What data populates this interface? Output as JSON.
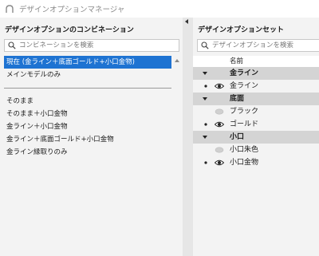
{
  "window": {
    "title": "デザインオプションマネージャ"
  },
  "left": {
    "title": "デザインオプションのコンビネーション",
    "search_placeholder": "コンビネーションを検索",
    "items_top": [
      {
        "label": "現在 (金ライン＋底面ゴールド+小口金物)",
        "selected": true
      },
      {
        "label": "メインモデルのみ",
        "selected": false
      }
    ],
    "items_bottom": [
      {
        "label": "そのまま"
      },
      {
        "label": "そのまま＋小口金物"
      },
      {
        "label": "金ライン＋小口金物"
      },
      {
        "label": "金ライン＋底面ゴールド+小口金物"
      },
      {
        "label": "金ライン縁取りのみ"
      }
    ]
  },
  "right": {
    "title": "デザインオプションセット",
    "search_placeholder": "デザインオプションを検索",
    "column_header": "名前",
    "groups": [
      {
        "name": "金ライン",
        "options": [
          {
            "name": "金ライン",
            "visible": true
          }
        ]
      },
      {
        "name": "底面",
        "options": [
          {
            "name": "ブラック",
            "visible": false
          },
          {
            "name": "ゴールド",
            "visible": true
          }
        ]
      },
      {
        "name": "小口",
        "options": [
          {
            "name": "小口朱色",
            "visible": false
          },
          {
            "name": "小口金物",
            "visible": true
          }
        ]
      }
    ]
  },
  "colors": {
    "selection": "#1e73d2",
    "group_row": "#d4d4d4",
    "pane_bg": "#f3f3f3"
  },
  "icons": {
    "app": "bend-arc-icon",
    "search": "search-icon",
    "visible": "eye-icon",
    "hidden": "eye-hidden-icon",
    "radio": "radio-dot-icon",
    "collapse": "caret-down-icon"
  }
}
